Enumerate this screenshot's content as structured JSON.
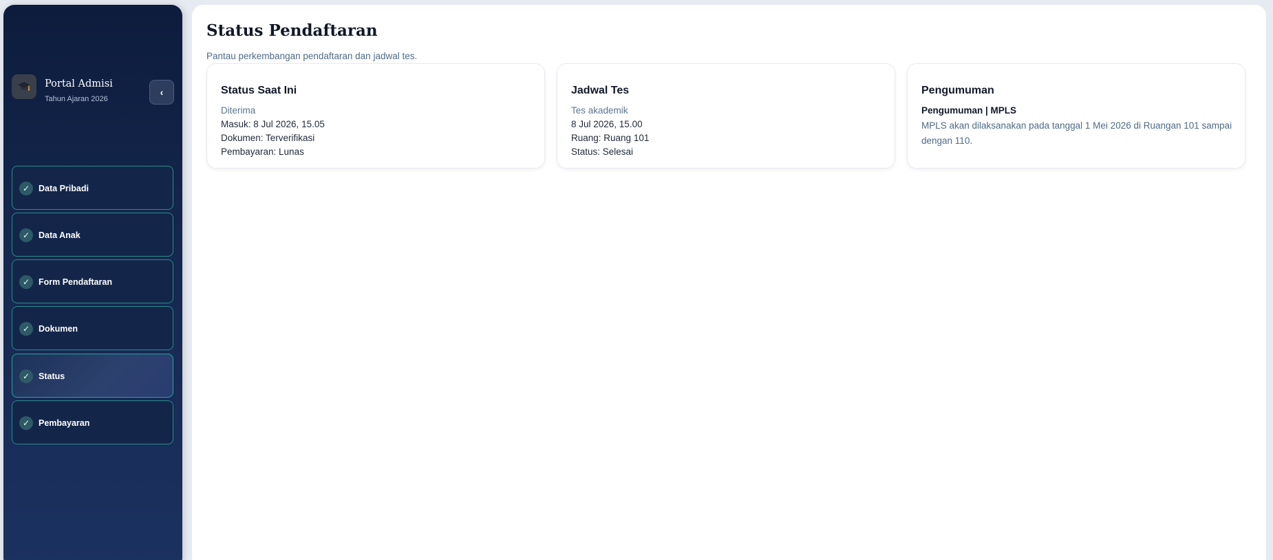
{
  "sidebar": {
    "brand_title": "Portal Admisi",
    "brand_subtitle": "Tahun Ajaran 2026",
    "brand_icon": "graduation-cap-icon",
    "collapse_label": "‹",
    "items": [
      {
        "label": "Data Pribadi",
        "done": true
      },
      {
        "label": "Data Anak",
        "done": true
      },
      {
        "label": "Form Pendaftaran",
        "done": true
      },
      {
        "label": "Dokumen",
        "done": true
      },
      {
        "label": "Status",
        "done": true,
        "active": true
      },
      {
        "label": "Pembayaran",
        "done": true
      }
    ]
  },
  "main": {
    "title": "Status Pendaftaran",
    "subtitle": "Pantau perkembangan pendaftaran dan jadwal tes."
  },
  "cards": {
    "status": {
      "title": "Status Saat Ini",
      "state": "Diterima",
      "entered": "Masuk: 8 Jul 2026, 15.05",
      "documents": "Dokumen: Terverifikasi",
      "payment": "Pembayaran: Lunas"
    },
    "test": {
      "title": "Jadwal Tes",
      "type": "Tes akademik",
      "datetime": "8 Jul 2026, 15.00",
      "room": "Ruang: Ruang 101",
      "status": "Status: Selesai"
    },
    "announcement": {
      "title": "Pengumuman",
      "heading": "Pengumuman | MPLS",
      "body": "MPLS akan dilaksanakan pada tanggal 1 Mei 2026 di Ruangan 101 sampai dengan 110."
    }
  },
  "colors": {
    "sidebar_bg": "#13264a",
    "accent_border": "#2a8c8a",
    "page_bg": "#e6eaf1"
  }
}
